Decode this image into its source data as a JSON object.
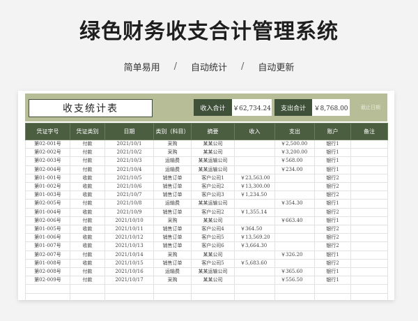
{
  "banner": {
    "title": "绿色财务收支合计管理系统",
    "features": [
      "简单易用",
      "自动统计",
      "自动更新"
    ],
    "separator": "/"
  },
  "colors": {
    "header_green": "#4b5e40",
    "bar_green": "#b7bd96",
    "label_green": "#3f5138"
  },
  "sheet": {
    "title": "收支统计表",
    "income_label": "收入合计",
    "income_value": "￥62,734.24",
    "expense_label": "支出合计",
    "expense_value": "￥8,768.00",
    "deadline_label": "截止日期",
    "columns": [
      "凭证字号",
      "凭证类别",
      "日期",
      "类别（科目）",
      "摘要",
      "收入",
      "支出",
      "账户",
      "备注"
    ],
    "rows": [
      [
        "第02-001号",
        "付款",
        "2021/10/1",
        "采购",
        "某某公司",
        "",
        "￥2,500.00",
        "银行1",
        ""
      ],
      [
        "第02-002号",
        "付款",
        "2021/10/2",
        "采购",
        "某某公司",
        "",
        "￥3,200.00",
        "银行1",
        ""
      ],
      [
        "第02-003号",
        "付款",
        "2021/10/3",
        "运输费",
        "某某运输公司",
        "",
        "￥568.00",
        "银行1",
        ""
      ],
      [
        "第02-004号",
        "付款",
        "2021/10/4",
        "运输费",
        "某某运输公司",
        "",
        "￥234.00",
        "银行1",
        ""
      ],
      [
        "第01-001号",
        "收款",
        "2021/10/5",
        "销售订单",
        "客户公司1",
        "￥23,563.00",
        "",
        "银行2",
        ""
      ],
      [
        "第01-002号",
        "收款",
        "2021/10/6",
        "销售订单",
        "客户公司2",
        "￥13,300.00",
        "",
        "银行2",
        ""
      ],
      [
        "第01-003号",
        "收款",
        "2021/10/7",
        "销售订单",
        "客户公司3",
        "￥1,234.50",
        "",
        "银行2",
        ""
      ],
      [
        "第02-005号",
        "付款",
        "2021/10/8",
        "运输费",
        "某某运输公司",
        "",
        "￥354.30",
        "银行1",
        ""
      ],
      [
        "第01-004号",
        "收款",
        "2021/10/9",
        "销售订单",
        "客户公司2",
        "￥1,355.14",
        "",
        "银行2",
        ""
      ],
      [
        "第02-006号",
        "付款",
        "2021/10/10",
        "采购",
        "某某公司",
        "",
        "￥663.40",
        "银行1",
        ""
      ],
      [
        "第01-005号",
        "收款",
        "2021/10/11",
        "销售订单",
        "客户公司4",
        "￥364.50",
        "",
        "银行2",
        ""
      ],
      [
        "第01-006号",
        "收款",
        "2021/10/12",
        "销售订单",
        "客户公司5",
        "￥13,569.20",
        "",
        "银行2",
        ""
      ],
      [
        "第01-007号",
        "收款",
        "2021/10/13",
        "销售订单",
        "客户公司6",
        "￥3,664.30",
        "",
        "银行2",
        ""
      ],
      [
        "第02-007号",
        "付款",
        "2021/10/14",
        "采购",
        "某某公司",
        "",
        "￥326.20",
        "银行1",
        ""
      ],
      [
        "第01-008号",
        "收款",
        "2021/10/15",
        "销售订单",
        "客户公司5",
        "￥5,683.60",
        "",
        "银行2",
        ""
      ],
      [
        "第02-008号",
        "付款",
        "2021/10/16",
        "运输费",
        "某某运输公司",
        "",
        "￥365.60",
        "银行1",
        ""
      ],
      [
        "第02-009号",
        "付款",
        "2021/10/17",
        "采购",
        "某某公司",
        "",
        "￥556.50",
        "银行1",
        ""
      ],
      [
        "",
        "",
        "",
        "",
        "",
        "",
        "",
        "",
        ""
      ],
      [
        "",
        "",
        "",
        "",
        "",
        "",
        "",
        "",
        ""
      ]
    ]
  }
}
